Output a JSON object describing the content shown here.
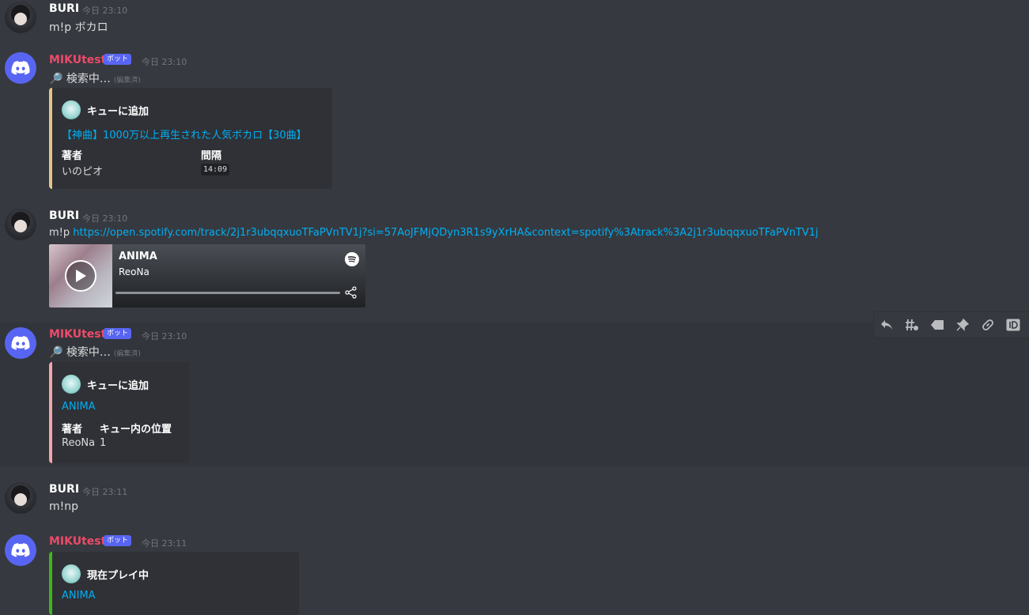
{
  "messages": [
    {
      "id": "m1",
      "author": "BURI",
      "timestamp": "今日 23:10",
      "text": "m!p ボカロ"
    },
    {
      "id": "m2",
      "author": "MIKUtest",
      "bot_tag": "ボット",
      "timestamp": "今日 23:10",
      "text": "🔎 検索中…",
      "edited": "(編集済)",
      "embed": {
        "accent": "#e3c587",
        "author_name": "キューに追加",
        "title": "【神曲】1000万以上再生された人気ボカロ【30曲】",
        "fields": [
          {
            "name": "著者",
            "value": "いのピオ"
          },
          {
            "name": "間隔",
            "value": "14:09"
          }
        ]
      }
    },
    {
      "id": "m3",
      "author": "BURI",
      "timestamp": "今日 23:10",
      "text_prefix": "m!p ",
      "link": "https://open.spotify.com/track/2j1r3ubqqxuoTFaPVnTV1j?si=57AoJFMjQDyn3R1s9yXrHA&context=spotify%3Atrack%3A2j1r3ubqqxuoTFaPVnTV1j",
      "spotify": {
        "track": "ANIMA",
        "artist": "ReoNa"
      }
    },
    {
      "id": "m4",
      "author": "MIKUtest",
      "bot_tag": "ボット",
      "timestamp": "今日 23:10",
      "text": "🔎 検索中…",
      "edited": "(編集済)",
      "embed": {
        "accent": "#f1a7a7",
        "author_name": "キューに追加",
        "title": "ANIMA",
        "fields": [
          {
            "name": "著者",
            "value": "ReoNa"
          },
          {
            "name": "キュー内の位置",
            "value": "1"
          }
        ]
      }
    },
    {
      "id": "m5",
      "author": "BURI",
      "timestamp": "今日 23:11",
      "text": "m!np"
    },
    {
      "id": "m6",
      "author": "MIKUtest",
      "bot_tag": "ボット",
      "timestamp": "今日 23:11",
      "embed": {
        "accent": "#3fb618",
        "author_name": "現在プレイ中",
        "title": "ANIMA"
      }
    }
  ],
  "toolbar": [
    "reply-icon",
    "thread-icon",
    "label-icon",
    "pin-icon",
    "link-icon",
    "id-icon"
  ],
  "colors": {
    "background": "#36393f",
    "embed_bg": "#2f3136",
    "bot_name": "#ed4a6a",
    "link": "#00aff4",
    "blurple": "#5865f2"
  }
}
